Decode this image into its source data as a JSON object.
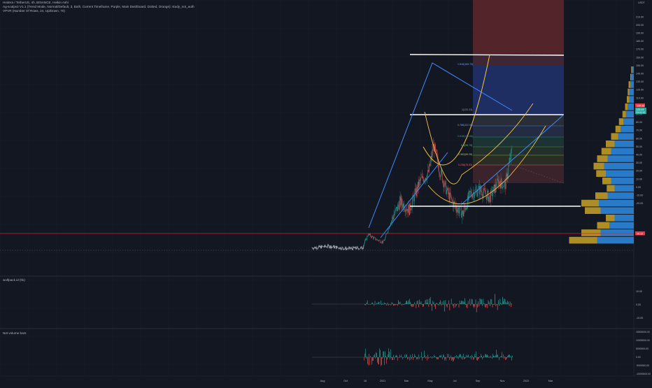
{
  "header": {
    "symbol_line": "Hedera / TetherUS, 4h, BINANCE, Heikin Ashi",
    "indicator_line_1": "Ag-scalpv2 V1.1 (Trend Mode, Normal/Default, 3, Both, Current Timeframe, Purple, Main Dashboard, Dotted, Orange): study_not_auth",
    "indicator_line_2": "VPVR (Number Of Rows, 24, Up/Down, 70)",
    "currency": "USDT"
  },
  "price_axis": {
    "ticks": [
      "210.00",
      "200.00",
      "190.00",
      "180.00",
      "170.00",
      "160.00",
      "150.00",
      "140.00",
      "130.00",
      "120.00",
      "110.00",
      "100.00",
      "90.00",
      "80.00",
      "70.00",
      "60.00",
      "50.00",
      "40.00",
      "30.00",
      "20.00",
      "10.00",
      "0.00",
      "-10.00",
      "-20.00"
    ],
    "last_price_badge": "126.38",
    "last_price_badge_2": "125.49",
    "countdown": "03:41:10",
    "horizontal_line_badge": "16.12",
    "colors": {
      "badge_green": "#26a69a",
      "badge_red": "#f23645",
      "badge_gray": "#4c525e"
    }
  },
  "fib_labels": {
    "level_1618": "1.618(183.73)",
    "level_1": "1(131.31)",
    "level_0786": "0.786(112.98)",
    "level_0618": "0.618(102.66)",
    "level_05": "0.5(95.79)",
    "level_0382": "0.382(85.28)",
    "level_0236": "0.236(75.53)"
  },
  "time_axis": {
    "ticks": [
      "Aug",
      "Oct",
      "16",
      "2021",
      "Mar",
      "May",
      "Jul",
      "Sep",
      "Nov",
      "2022",
      "Mar"
    ]
  },
  "panes": {
    "wolfpack": {
      "label": "wolfpack id (hk)",
      "ticks": [
        "10.00",
        "0.00",
        "-10.00"
      ]
    },
    "net_volume": {
      "label": "Net volume bars",
      "ticks": [
        "15000000.00",
        "10000000.00",
        "5000000.00",
        "0.00",
        "-5000000.00",
        "-10000000.00"
      ]
    }
  },
  "chart_data": {
    "type": "candlestick",
    "x": [
      "Aug 2020",
      "Oct 2020",
      "Dec 16 2020",
      "Jan 2021",
      "Mar 2021",
      "May 2021",
      "Jul 2021",
      "Sep 2021",
      "Nov 2021"
    ],
    "close": [
      3.0,
      1.0,
      9.0,
      22.0,
      62.0,
      128.0,
      45.0,
      75.0,
      126.38
    ],
    "ylim": [
      -25,
      215
    ],
    "horizontal_levels": [
      16.12,
      40.0,
      125.0,
      180.0
    ],
    "volume_profile_rows": 24,
    "colors": {
      "up_candle": "#26a69a",
      "down_candle": "#ef5350",
      "trendline_blue": "#3d8bfd",
      "curve_gold": "#f5c242",
      "level_white": "#ffffff",
      "level_red": "#e02020",
      "vp_up": "#2a7fd1",
      "vp_down": "#c9a227"
    }
  }
}
